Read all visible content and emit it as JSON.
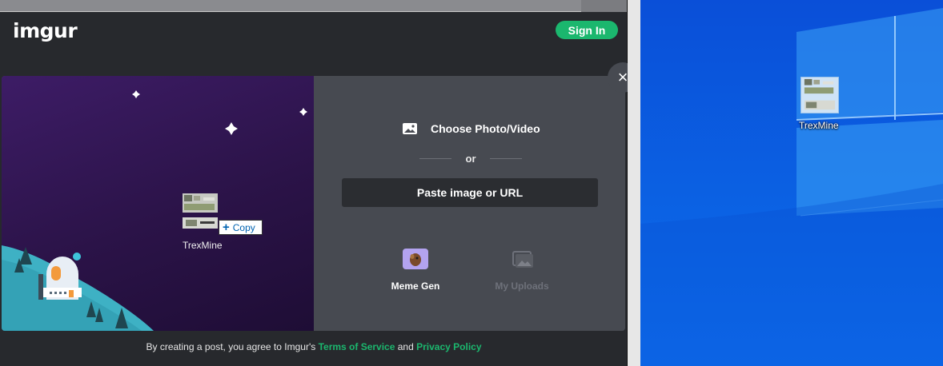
{
  "app": {
    "logo": "imgur",
    "signin_label": "Sign In"
  },
  "upload": {
    "choose_label": "Choose Photo/Video",
    "or_label": "or",
    "paste_label": "Paste image or URL",
    "tools": [
      {
        "label": "Meme Gen",
        "icon": "meme-gen-icon"
      },
      {
        "label": "My Uploads",
        "icon": "my-uploads-icon"
      }
    ],
    "close_icon": "×"
  },
  "footer": {
    "prefix": "By creating a post, you agree to Imgur's ",
    "tos": "Terms of Service",
    "and": " and ",
    "privacy": "Privacy Policy"
  },
  "drag": {
    "file_name": "TrexMine",
    "copy_label": "Copy"
  },
  "desktop": {
    "icon_name": "TrexMine"
  },
  "colors": {
    "accent_green": "#1bb76e",
    "modal_bg": "#474a51",
    "art_purple": "#3d1c66",
    "desktop_blue": "#0b61e3"
  }
}
